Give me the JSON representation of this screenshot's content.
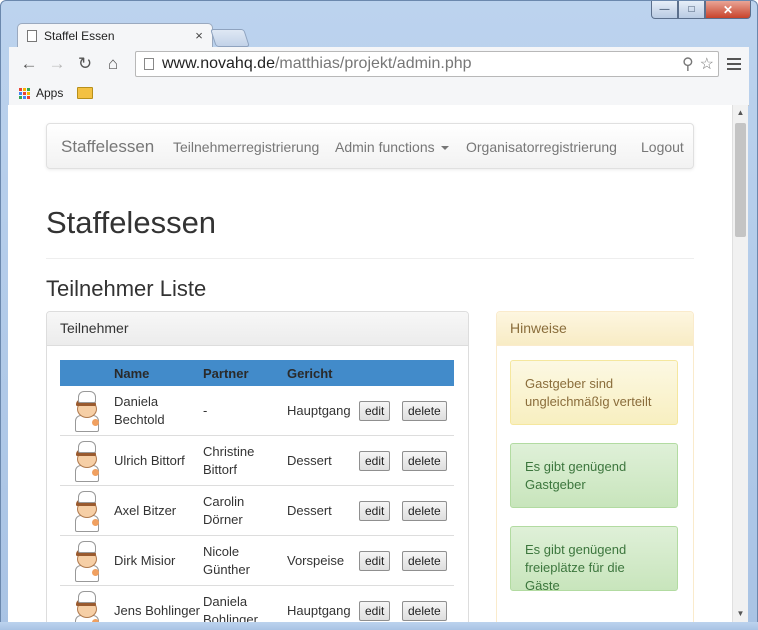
{
  "browser": {
    "tab_title": "Staffel Essen",
    "tab_close": "×",
    "url_host": "www.novahq.de",
    "url_path": "/matthias/projekt/admin.php",
    "bookmarks": {
      "apps_label": "Apps"
    }
  },
  "navbar": {
    "brand": "Staffelessen",
    "links": {
      "participant_registration": "Teilnehmerregistrierung",
      "admin_functions": "Admin functions",
      "organizer_registration": "Organisatorregistrierung",
      "logout": "Logout"
    }
  },
  "page": {
    "title": "Staffelessen",
    "section_title": "Teilnehmer Liste"
  },
  "participants_panel": {
    "heading": "Teilnehmer",
    "columns": {
      "name": "Name",
      "partner": "Partner",
      "dish": "Gericht"
    },
    "edit_label": "edit",
    "delete_label": "delete",
    "rows": [
      {
        "name": "Daniela Bechtold",
        "partner": "-",
        "dish": "Hauptgang"
      },
      {
        "name": "Ulrich Bittorf",
        "partner": "Christine Bittorf",
        "dish": "Dessert"
      },
      {
        "name": "Axel Bitzer",
        "partner": "Carolin Dörner",
        "dish": "Dessert"
      },
      {
        "name": "Dirk Misior",
        "partner": "Nicole Günther",
        "dish": "Vorspeise"
      },
      {
        "name": "Jens Bohlinger",
        "partner": "Daniela Bohlinger",
        "dish": "Hauptgang"
      }
    ]
  },
  "hints_panel": {
    "heading": "Hinweise",
    "alerts": [
      {
        "type": "warning",
        "text": "Gastgeber sind ungleichmäßig verteilt"
      },
      {
        "type": "success",
        "text": "Es gibt genügend Gastgeber"
      },
      {
        "type": "success",
        "text": "Es gibt genügend freieplätze für die Gäste"
      }
    ]
  },
  "colors": {
    "table_header": "#428bca",
    "warning_text": "#8a6d3b",
    "success_text": "#3c763d"
  }
}
